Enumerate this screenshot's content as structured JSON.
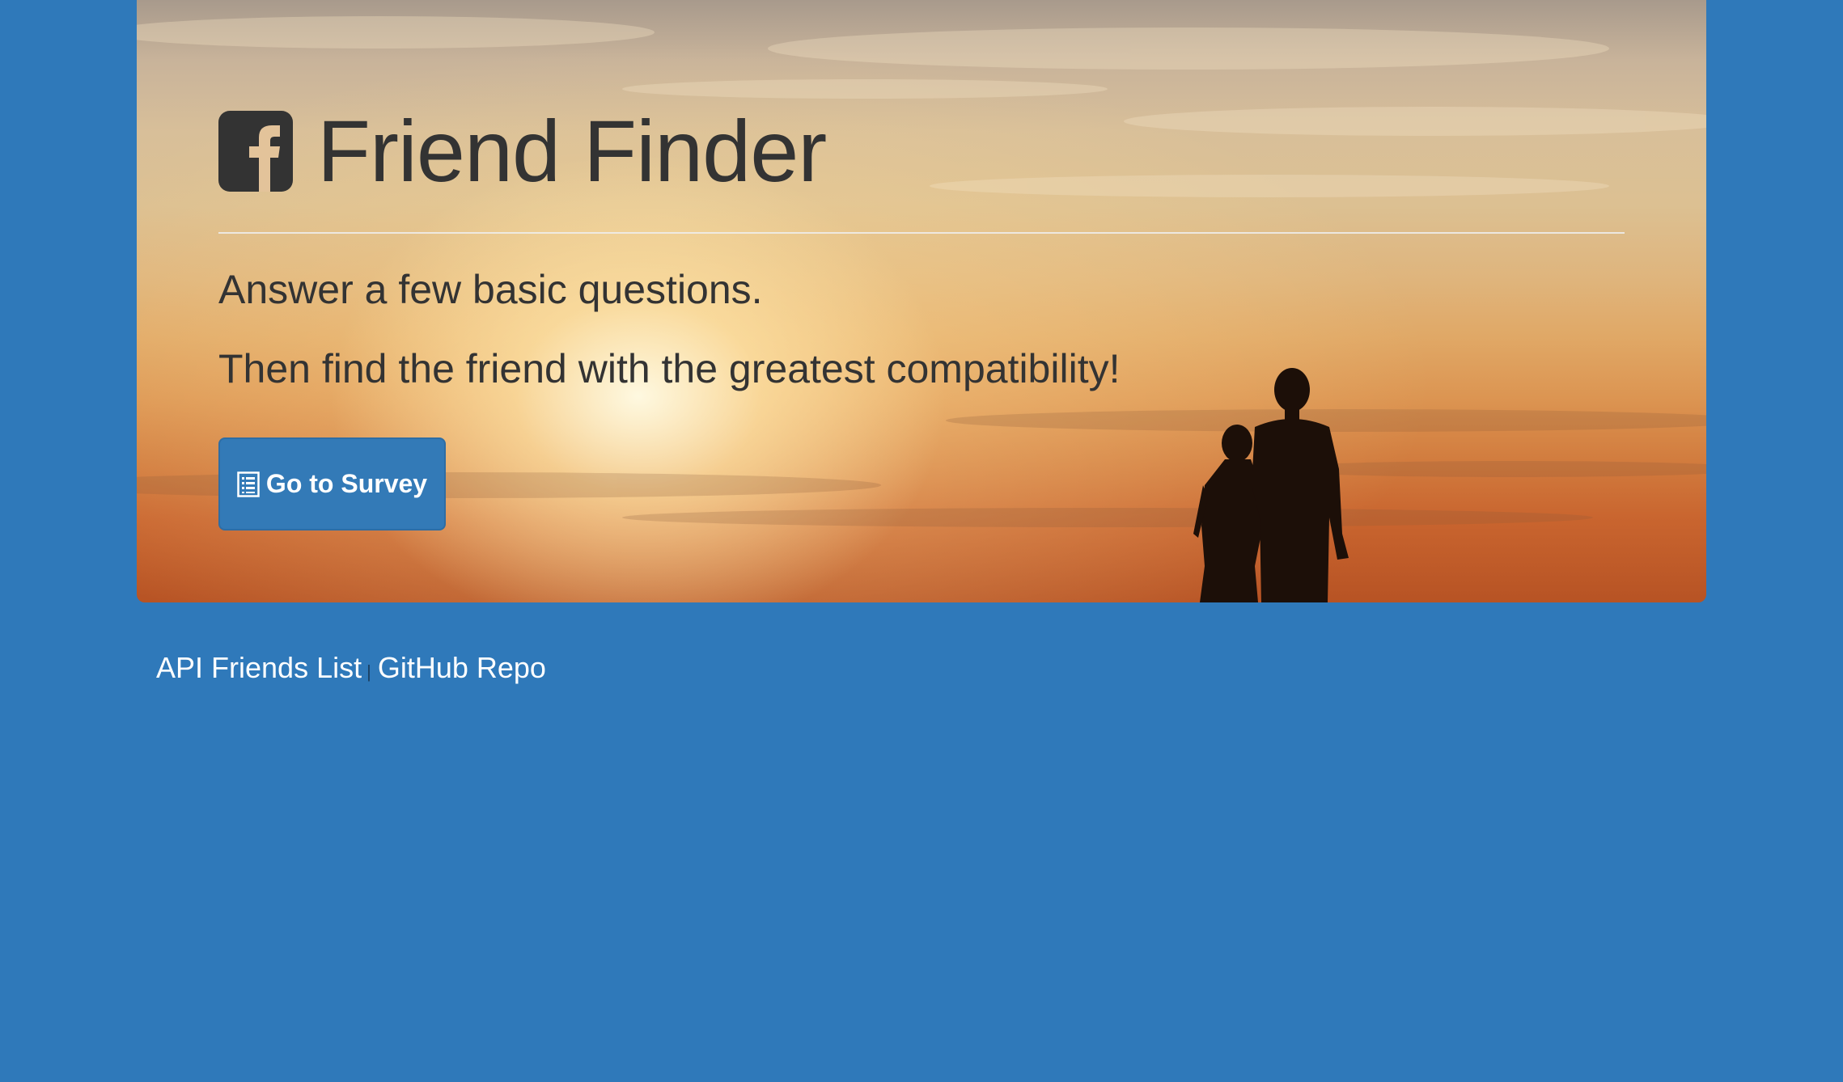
{
  "jumbotron": {
    "title": "Friend Finder",
    "lead_line_1": "Answer a few basic questions.",
    "lead_line_2": "Then find the friend with the greatest compatibility!",
    "survey_button_label": "Go to Survey",
    "title_icon": "facebook-square-icon",
    "button_icon": "list-alt-icon"
  },
  "footer": {
    "links": [
      {
        "label": "API Friends List"
      },
      {
        "label": "GitHub Repo"
      }
    ],
    "separator": "|"
  },
  "colors": {
    "page_background": "#2f79ba",
    "button_background": "#337ab7",
    "text_dark": "#333333",
    "text_light": "#ffffff"
  }
}
